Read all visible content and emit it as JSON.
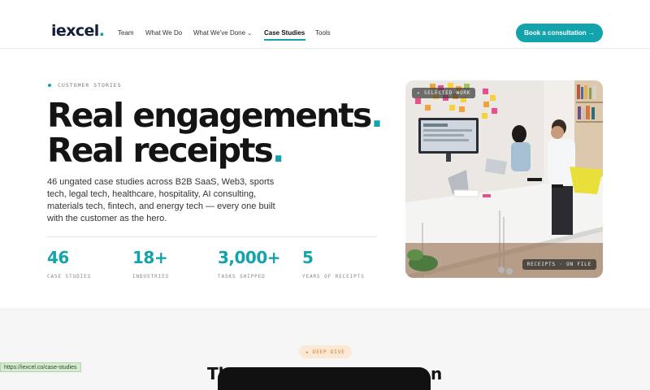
{
  "brand": {
    "name": "iexcel",
    "accent": "#13a3ad",
    "dark": "#13203a"
  },
  "nav": {
    "items": [
      "Team",
      "What We Do",
      "What We've Done",
      "Case Studies",
      "Tools"
    ],
    "active": "Case Studies"
  },
  "cta": {
    "label": "Book a consultation →"
  },
  "hero": {
    "eyebrow": "CUSTOMER STORIES",
    "headline_line1": "Real engagements",
    "headline_line2": "Real receipts",
    "description": "46 ungated case studies across B2B SaaS, Web3, sports tech, legal tech, healthcare, hospitality, AI consulting, materials tech, fintech, and energy tech — every one built with the customer as the hero.",
    "stats": [
      {
        "value": "46",
        "label": "CASE STUDIES"
      },
      {
        "value": "18+",
        "label": "INDUSTRIES"
      },
      {
        "value": "3,000+",
        "label": "TASKS SHIPPED"
      },
      {
        "value": "5",
        "label": "YEARS OF RECEIPTS"
      }
    ]
  },
  "photo": {
    "badge_top": "✦ SELECTED WORK",
    "badge_bottom": "RECEIPTS · ON FILE"
  },
  "deep_dive": {
    "pill": "★ DEEP DIVE",
    "title_start": "Th",
    "title_end": "n"
  },
  "status_bar": {
    "url": "https://iexcel.co/case-studies"
  }
}
